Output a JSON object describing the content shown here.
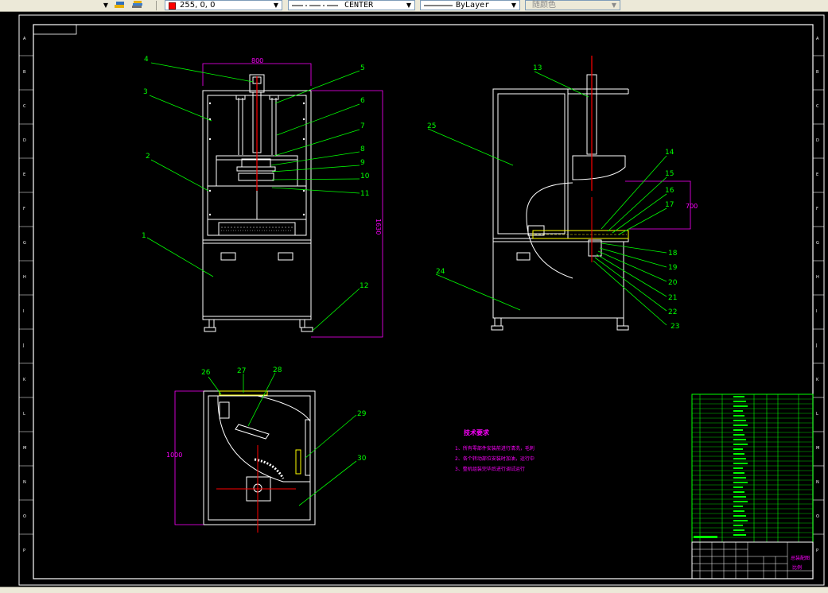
{
  "toolbar": {
    "color_value": "255, 0, 0",
    "color_hex": "#ff0000",
    "linetype": "CENTER",
    "lineweight": "ByLayer",
    "plot_style": "随颜色"
  },
  "drawing": {
    "colors": {
      "outline": "#ffffff",
      "leader": "#00ff00",
      "dimension": "#ff00ff",
      "centerline": "#ff0000",
      "highlight": "#ffff00",
      "table": "#00ff00"
    },
    "front_view": {
      "width_dim": "800",
      "height_dim": "1630",
      "balloons": [
        "1",
        "2",
        "3",
        "4",
        "5",
        "6",
        "7",
        "8",
        "9",
        "10",
        "11",
        "12"
      ]
    },
    "side_view": {
      "width_dim": "700",
      "balloons": [
        "13",
        "14",
        "15",
        "16",
        "17",
        "18",
        "19",
        "20",
        "21",
        "22",
        "23",
        "24",
        "25"
      ]
    },
    "top_view": {
      "height_dim": "1000",
      "balloons": [
        "26",
        "27",
        "28",
        "29",
        "30"
      ]
    },
    "notes": {
      "title": "技术要求",
      "lines": [
        "1、所有零部件安装前进行清洗，毛刺",
        "2、各个转动部位安装时加油，运行中",
        "3、整机组装完毕后进行调试运行"
      ]
    },
    "title_block": {
      "name": "总装配图",
      "scale": "比例"
    }
  }
}
